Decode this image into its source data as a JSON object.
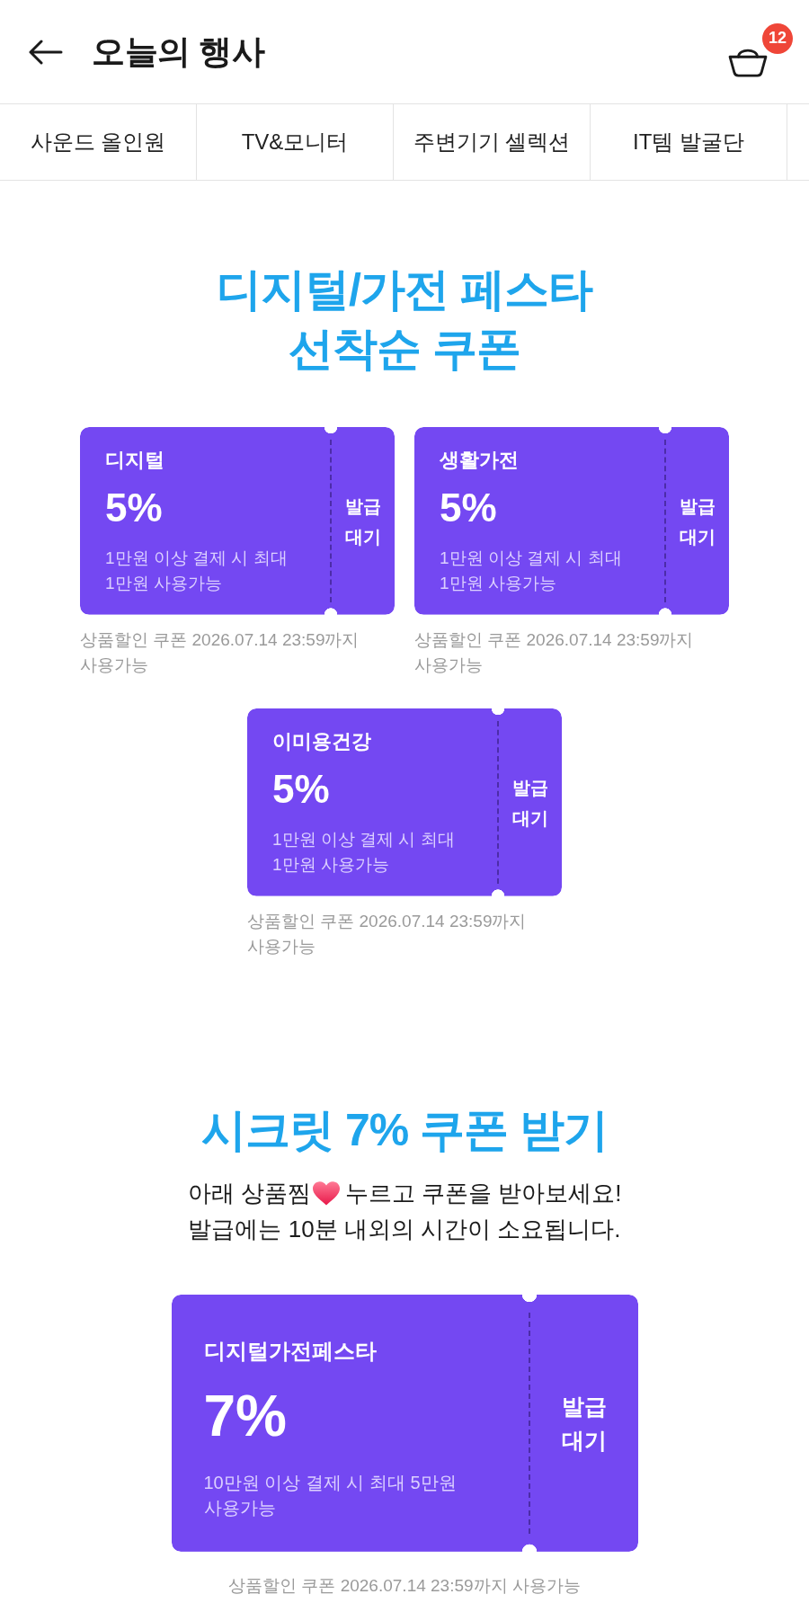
{
  "header": {
    "title": "오늘의 행사",
    "cart_count": "12"
  },
  "tabs": [
    {
      "label": "사운드 올인원"
    },
    {
      "label": "TV&모니터"
    },
    {
      "label": "주변기기 셀렉션"
    },
    {
      "label": "IT템 발굴단"
    }
  ],
  "fest_section": {
    "title_lines": [
      "디지털/가전 페스타",
      "선착순 쿠폰"
    ],
    "coupons": [
      {
        "category": "디지털",
        "rate": "5%",
        "condition": "1만원 이상 결제 시 최대 1만원 사용가능",
        "status": "발급 대기",
        "validity": "상품할인 쿠폰 2026.07.14 23:59까지 사용가능"
      },
      {
        "category": "생활가전",
        "rate": "5%",
        "condition": "1만원 이상 결제 시 최대 1만원 사용가능",
        "status": "발급 대기",
        "validity": "상품할인 쿠폰 2026.07.14 23:59까지 사용가능"
      },
      {
        "category": "이미용건강",
        "rate": "5%",
        "condition": "1만원 이상 결제 시 최대 1만원 사용가능",
        "status": "발급 대기",
        "validity": "상품할인 쿠폰 2026.07.14 23:59까지 사용가능"
      }
    ]
  },
  "secret_section": {
    "title": "시크릿 7% 쿠폰 받기",
    "notice": {
      "lead": "아래 상품찜",
      "tail": "누르고 쿠폰을 받아보세요!",
      "second_line": "발급에는 10분 내외의 시간이 소요됩니다."
    },
    "coupon": {
      "category": "디지털가전페스타",
      "rate": "7%",
      "condition": "10만원 이상 결제 시 최대 5만원 사용가능",
      "status": "발급 대기",
      "validity": "상품할인 쿠폰 2026.07.14 23:59까지 사용가능"
    }
  }
}
